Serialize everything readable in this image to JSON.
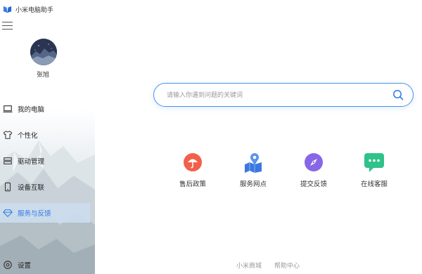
{
  "app": {
    "title": "小米电脑助手"
  },
  "user": {
    "name": "张旭"
  },
  "sidebar": {
    "items": [
      {
        "label": "我的电脑",
        "icon": "laptop-icon"
      },
      {
        "label": "个性化",
        "icon": "tshirt-icon"
      },
      {
        "label": "驱动管理",
        "icon": "driver-icon"
      },
      {
        "label": "设备互联",
        "icon": "phone-icon"
      },
      {
        "label": "服务与反馈",
        "icon": "diamond-icon",
        "active": true
      },
      {
        "label": "设置",
        "icon": "settings-icon"
      }
    ]
  },
  "search": {
    "placeholder": "请输入你遇到问题的关键词",
    "value": ""
  },
  "services": [
    {
      "label": "售后政策",
      "icon": "umbrella-icon",
      "color": "#f2604a"
    },
    {
      "label": "服务网点",
      "icon": "map-pin-icon",
      "color": "#3a78e0"
    },
    {
      "label": "提交反馈",
      "icon": "compass-icon",
      "color": "#8867e6"
    },
    {
      "label": "在线客服",
      "icon": "chat-icon",
      "color": "#2fc28a"
    }
  ],
  "footer": {
    "links": [
      "小米商城",
      "帮助中心"
    ]
  },
  "colors": {
    "accent": "#2f7ae5",
    "search_border": "#4a93e6"
  }
}
